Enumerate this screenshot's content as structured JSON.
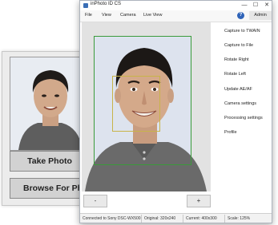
{
  "background_app": {
    "take_photo_label": "Take Photo",
    "browse_label": "Browse For Photo"
  },
  "window": {
    "title": "inPhoto ID CS",
    "controls": {
      "minimize": "—",
      "maximize": "☐",
      "close": "✕"
    },
    "menu": [
      "File",
      "View",
      "Camera",
      "Live View"
    ],
    "help_icon": "?",
    "admin_label": "Admin",
    "side_menu": [
      "Capture to TWAIN",
      "Capture to File",
      "Rotate Right",
      "Rotate Left",
      "Update AE/AF",
      "Camera settings",
      "Processing settings",
      "Profile"
    ],
    "zoom_out_label": "-",
    "zoom_in_label": "+",
    "status": {
      "connection": "Connected to Sony DSC-WX500",
      "original": "Original: 320x240",
      "current": "Current: 400x300",
      "scale": "Scale: 125%"
    }
  },
  "colors": {
    "frame_border": "#3a9b3a",
    "face_box_border": "#c8b449",
    "help_icon": "#2e63b8"
  }
}
